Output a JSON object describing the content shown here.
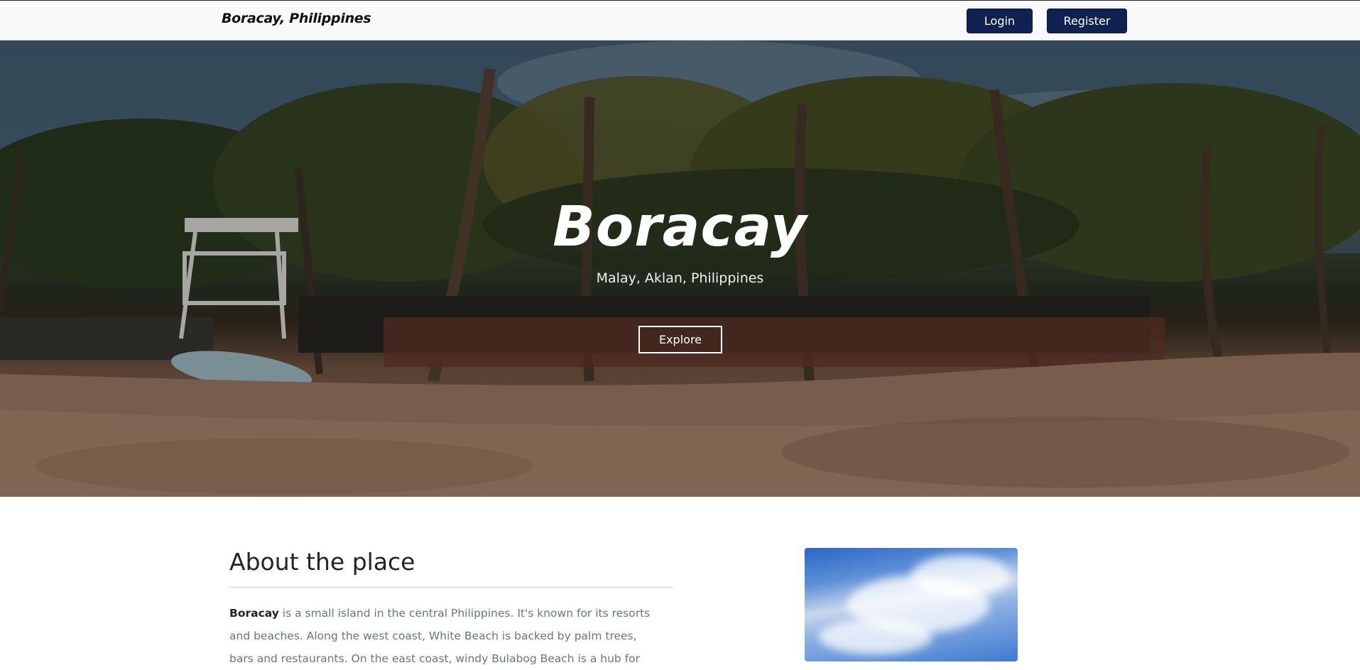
{
  "navbar": {
    "brand": "Boracay, Philippines",
    "login_label": "Login",
    "register_label": "Register"
  },
  "hero": {
    "title": "Boracay",
    "subtitle": "Malay, Aklan, Philippines",
    "explore_label": "Explore"
  },
  "about": {
    "title": "About the place",
    "text_bold": "Boracay",
    "text_rest": " is a small island in the central Philippines. It's known for its resorts and beaches. Along the west coast, White Beach is backed by palm trees, bars and restaurants. On the east coast, windy Bulabog Beach is a hub for"
  },
  "colors": {
    "nav_bg": "#f8f9fa",
    "button_bg": "#0f2150",
    "text_muted": "#6c757d"
  },
  "icons": []
}
